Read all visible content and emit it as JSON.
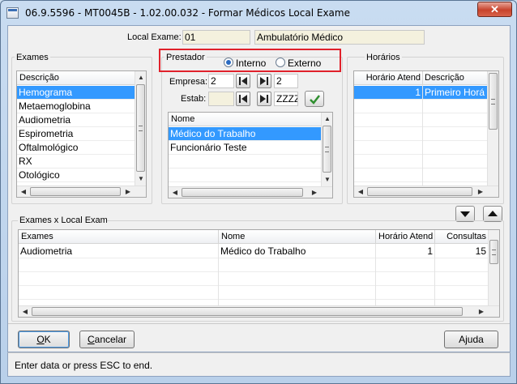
{
  "window": {
    "title": "06.9.5596 - MT0045B - 1.02.00.032 - Formar Médicos Local Exame",
    "close_glyph": "✕"
  },
  "header": {
    "local_exame_label": "Local Exame:",
    "local_exame_code": "01",
    "local_exame_desc": "Ambulatório Médico"
  },
  "exames": {
    "title": "Exames",
    "column": "Descrição",
    "items": [
      "Hemograma",
      "Metaemoglobina",
      "Audiometria",
      "Espirometria",
      "Oftalmológico",
      "RX",
      "Otológico"
    ],
    "selected_index": 0
  },
  "prestador": {
    "title": "Prestador",
    "options": [
      "Interno",
      "Externo"
    ],
    "selected": "Interno",
    "empresa_label": "Empresa:",
    "empresa_from": "2",
    "empresa_to": "2",
    "estab_label": "Estab:",
    "estab_from": "",
    "estab_to": "ZZZZ",
    "column": "Nome",
    "items": [
      "Médico do Trabalho",
      "Funcionário Teste"
    ],
    "selected_index": 0
  },
  "horarios": {
    "title": "Horários",
    "columns": [
      "Horário Atend",
      "Descrição"
    ],
    "rows": [
      {
        "horario": "1",
        "descricao": "Primeiro Horá"
      }
    ]
  },
  "local_exame_grid": {
    "title": "Exames x Local Exame",
    "columns": [
      "Exames",
      "Nome",
      "Horário Atend",
      "Consultas"
    ],
    "rows": [
      {
        "exame": "Audiometria",
        "nome": "Médico do Trabalho",
        "horario": "1",
        "consultas": "15"
      }
    ]
  },
  "buttons": {
    "ok": "OK",
    "ok_mnemonic": "O",
    "ok_rest": "K",
    "cancelar": "Cancelar",
    "cancelar_mnemonic": "C",
    "cancelar_rest": "ancelar",
    "ajuda": "Ajuda"
  },
  "status": {
    "text": "Enter data or press ESC to end."
  },
  "colors": {
    "selection": "#3399ff",
    "highlight_border": "#e0212b",
    "field_bg": "#f4f1de"
  }
}
